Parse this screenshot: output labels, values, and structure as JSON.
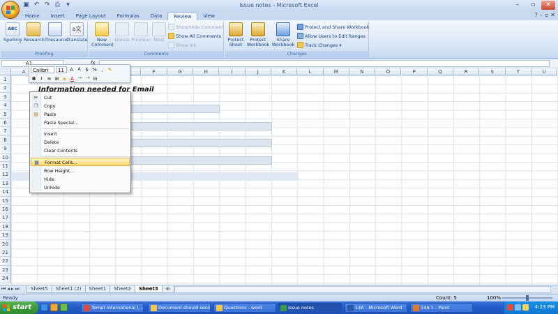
{
  "window": {
    "title": "Issue notes - Microsoft Excel"
  },
  "ribbon_tabs": [
    "Home",
    "Insert",
    "Page Layout",
    "Formulas",
    "Data",
    "Review",
    "View"
  ],
  "active_tab": "Review",
  "ribbon": {
    "proofing": {
      "label": "Proofing",
      "spelling": "Spelling",
      "research": "Research",
      "thesaurus": "Thesaurus",
      "translate": "Translate"
    },
    "comments": {
      "label": "Comments",
      "new_comment": "New Comment",
      "delete": "Delete",
      "previous": "Previous",
      "next": "Next",
      "show_hide": "Show/Hide Comment",
      "show_all": "Show All Comments",
      "show_ink": "Show Ink"
    },
    "changes": {
      "label": "Changes",
      "protect_sheet": "Protect Sheet",
      "protect_workbook": "Protect Workbook",
      "share_workbook": "Share Workbook",
      "protect_share": "Protect and Share Workbook",
      "allow_users": "Allow Users to Edit Ranges",
      "track_changes": "Track Changes"
    }
  },
  "formula_bar": {
    "name_box": "A1",
    "fx": "fx",
    "formula": ""
  },
  "columns": [
    "A",
    "B",
    "C",
    "D",
    "E",
    "F",
    "G",
    "H",
    "I",
    "J",
    "K",
    "L",
    "M",
    "N",
    "O",
    "P",
    "Q",
    "R",
    "S",
    "T",
    "U"
  ],
  "rows": [
    "1",
    "2",
    "3",
    "4",
    "5",
    "6",
    "7",
    "8",
    "9",
    "10",
    "11",
    "12",
    "13",
    "14",
    "15",
    "16",
    "17",
    "18",
    "19",
    "20",
    "21",
    "22",
    "23",
    "24"
  ],
  "cell_content": {
    "title": "Information needed for Email"
  },
  "mini_toolbar": {
    "font": "Calibri",
    "size": "11",
    "grow": "A",
    "shrink": "A",
    "currency": "$",
    "percent": "%",
    "bold": "B",
    "italic": "I",
    "align": "≡",
    "font_color": "A"
  },
  "context_menu": [
    {
      "label": "Cut",
      "icon": "scissors-icon"
    },
    {
      "label": "Copy",
      "icon": "copy-icon"
    },
    {
      "label": "Paste",
      "icon": "paste-icon"
    },
    {
      "label": "Paste Special...",
      "icon": ""
    },
    {
      "label": "Insert",
      "icon": ""
    },
    {
      "label": "Delete",
      "icon": ""
    },
    {
      "label": "Clear Contents",
      "icon": ""
    },
    {
      "label": "Format Cells...",
      "icon": "format-cells-icon"
    },
    {
      "label": "Row Height...",
      "icon": ""
    },
    {
      "label": "Hide",
      "icon": ""
    },
    {
      "label": "Unhide",
      "icon": ""
    }
  ],
  "highlighted_menu_item": "Format Cells...",
  "sheets": [
    "Sheet5",
    "Sheet1 (2)",
    "Sheet1",
    "Sheet2",
    "Sheet3"
  ],
  "active_sheet": "Sheet3",
  "status": {
    "ready": "Ready",
    "count": "Count: 5",
    "zoom": "100%"
  },
  "taskbar": {
    "start": "start",
    "items": [
      "Tempt International (...",
      "Document should send",
      "Questions - word",
      "Issue notes",
      "14A - Microsoft Word",
      "14A.1 - Paint"
    ],
    "active": "Issue notes",
    "clock": "4:23 PM"
  },
  "colors": {
    "ribbon_text": "#15428b",
    "highlight": "#ffd96b",
    "taskbar": "#245dcb",
    "start": "#3c9a3a"
  }
}
